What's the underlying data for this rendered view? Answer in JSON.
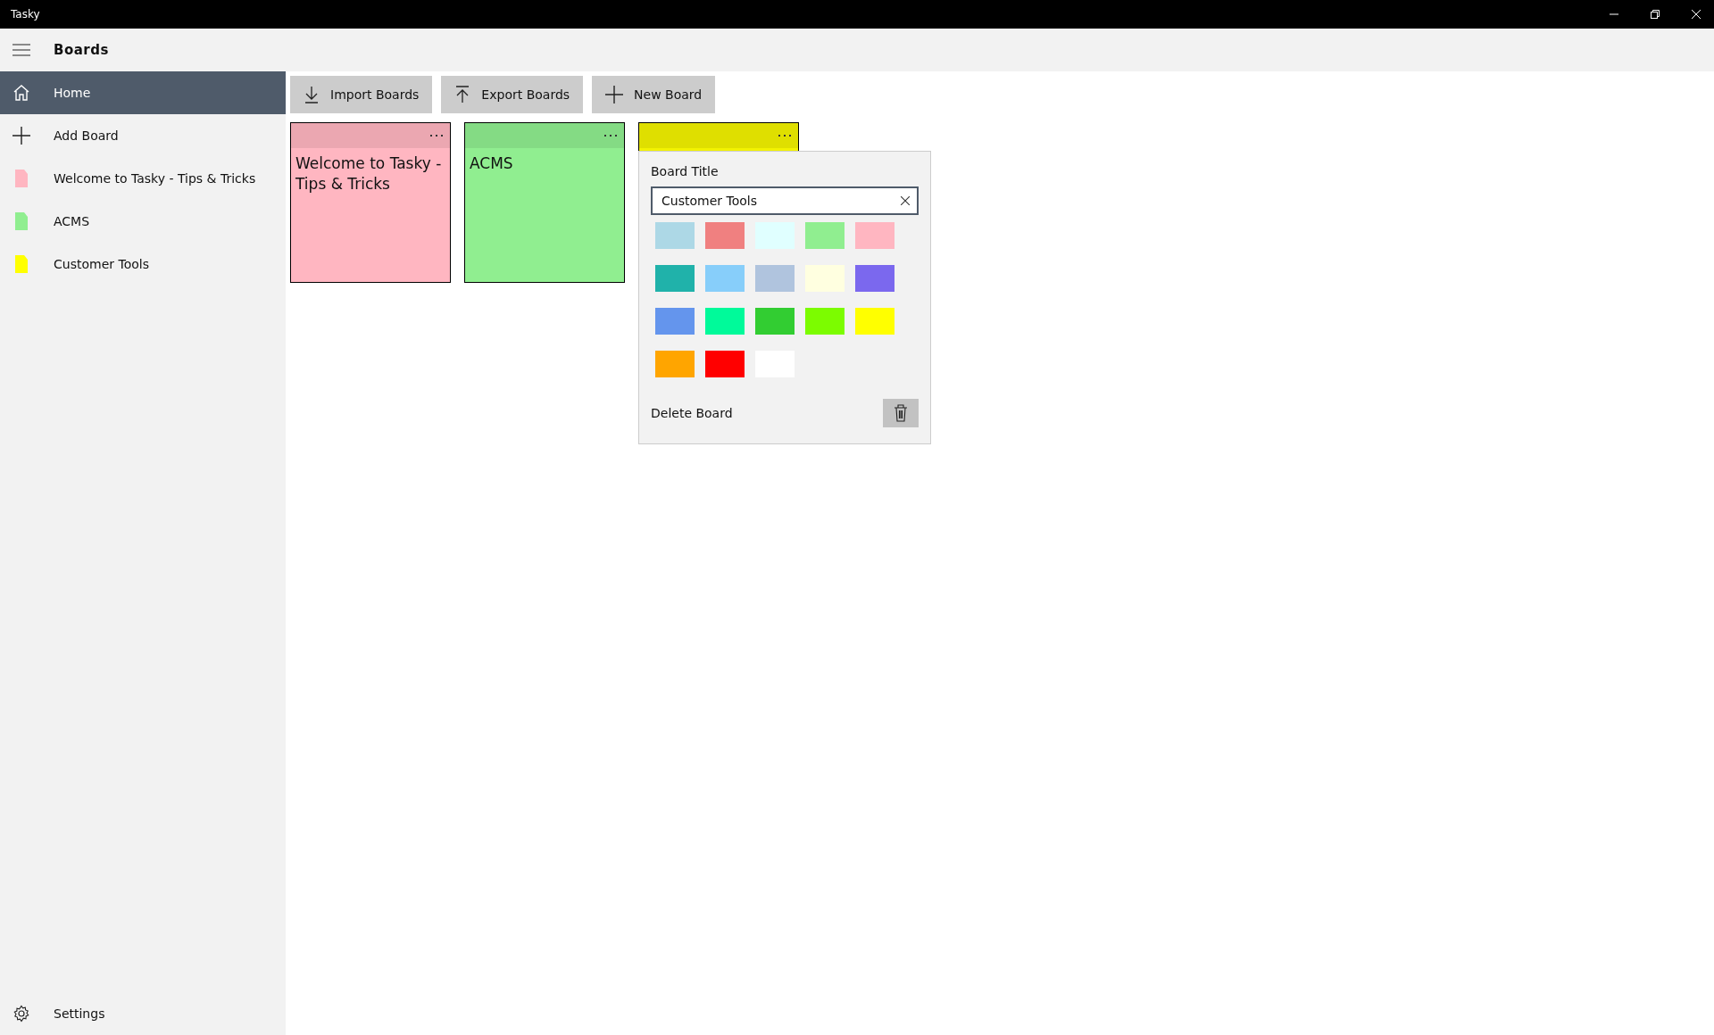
{
  "window": {
    "title": "Tasky"
  },
  "header": {
    "title": "Boards"
  },
  "sidebar": {
    "items": [
      {
        "kind": "home",
        "label": "Home",
        "selected": true
      },
      {
        "kind": "add",
        "label": "Add Board",
        "selected": false
      },
      {
        "kind": "board",
        "label": "Welcome to Tasky - Tips & Tricks",
        "color": "#ffb6c1",
        "selected": false
      },
      {
        "kind": "board",
        "label": "ACMS",
        "color": "#90ee90",
        "selected": false
      },
      {
        "kind": "board",
        "label": "Customer Tools",
        "color": "#ffff00",
        "selected": false
      }
    ],
    "footer": {
      "kind": "settings",
      "label": "Settings"
    }
  },
  "toolbar": [
    {
      "kind": "import",
      "label": "Import Boards"
    },
    {
      "kind": "export",
      "label": "Export Boards"
    },
    {
      "kind": "add",
      "label": "New Board"
    }
  ],
  "cards": [
    {
      "title": "Welcome to Tasky - Tips & Tricks",
      "color": "#ffb6c1"
    },
    {
      "title": "ACMS",
      "color": "#90ee90"
    },
    {
      "color": "#f2f200"
    }
  ],
  "popup": {
    "label": "Board Title",
    "value": "Customer Tools",
    "swatches": [
      {
        "color": "#add8e6"
      },
      {
        "color": "#f08080"
      },
      {
        "color": "#e0ffff"
      },
      {
        "color": "#90ee90"
      },
      {
        "color": "#ffb6c1"
      },
      {
        "color": "#20b2aa"
      },
      {
        "color": "#87cefa"
      },
      {
        "color": "#b0c4de"
      },
      {
        "color": "#ffffe0"
      },
      {
        "color": "#7b68ee"
      },
      {
        "color": "#6495ed"
      },
      {
        "color": "#00fa9a"
      },
      {
        "color": "#32cd32"
      },
      {
        "color": "#7cfc00"
      },
      {
        "color": "#ffff00"
      },
      {
        "color": "#ffa500"
      },
      {
        "color": "#ff0000"
      },
      {
        "color": "#ffffff"
      }
    ],
    "delete_label": "Delete Board"
  }
}
